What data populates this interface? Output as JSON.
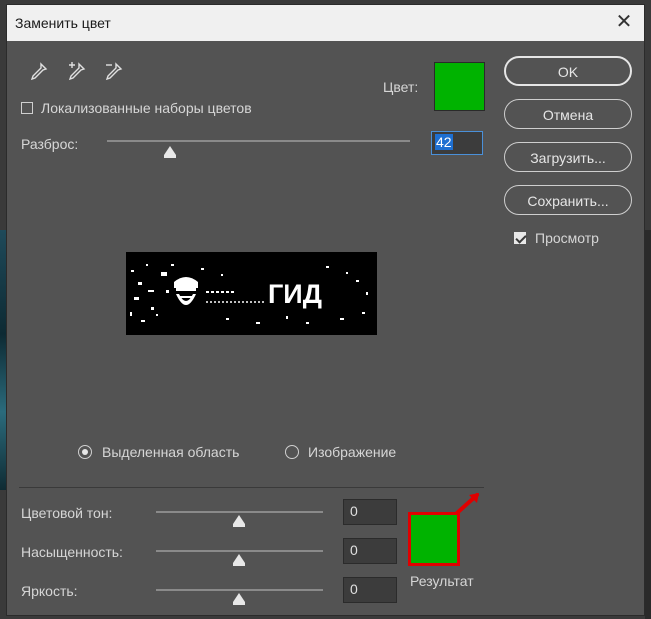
{
  "window": {
    "title": "Заменить цвет",
    "close_glyph": "✕"
  },
  "tools": [
    {
      "name": "eyedropper-icon"
    },
    {
      "name": "eyedropper-plus-icon"
    },
    {
      "name": "eyedropper-minus-icon"
    }
  ],
  "localized": {
    "label": "Локализованные наборы цветов",
    "checked": false
  },
  "color": {
    "label": "Цвет:",
    "value": "#00b300"
  },
  "fuzziness": {
    "label": "Разброс:",
    "value": "42"
  },
  "buttons": {
    "ok": "OK",
    "cancel": "Отмена",
    "load": "Загрузить...",
    "save": "Сохранить..."
  },
  "preview_toggle": {
    "label": "Просмотр",
    "checked": true
  },
  "preview_image": {
    "text": "ГИД"
  },
  "view_mode": {
    "selection": "Выделенная область",
    "image": "Изображение",
    "selected": "selection"
  },
  "replacement": {
    "hue": {
      "label": "Цветовой тон:",
      "value": "0"
    },
    "saturation": {
      "label": "Насыщенность:",
      "value": "0"
    },
    "lightness": {
      "label": "Яркость:",
      "value": "0"
    },
    "result_label": "Результат",
    "result_color": "#00b300",
    "highlight_color": "#e00000"
  }
}
